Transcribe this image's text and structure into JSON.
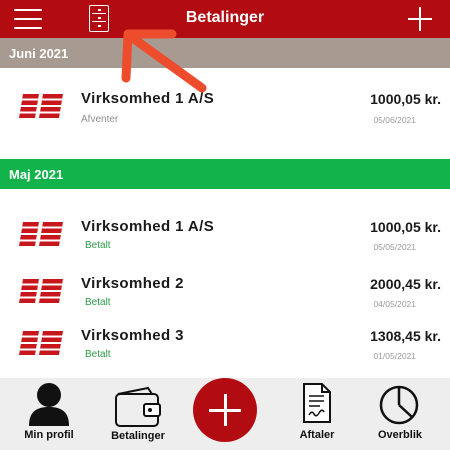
{
  "header": {
    "title": "Betalinger",
    "menu_icon": "hamburger-menu-icon",
    "archive_icon": "file-cabinet-icon",
    "add_icon": "plus-icon"
  },
  "colors": {
    "brand": "#b20b11",
    "june_section": "#a79b91",
    "may_section": "#12b34b",
    "paid_status": "#2e9a48",
    "tutorial_arrow": "#ee4d2d"
  },
  "sections": [
    {
      "title": "Juni 2021",
      "payments": [
        {
          "logo": "DS",
          "company": "Virksomhed 1 A/S",
          "status": "Afventer",
          "amount": "1000,05 kr.",
          "date": "05/06/2021"
        }
      ]
    },
    {
      "title": "Maj 2021",
      "payments": [
        {
          "logo": "DS",
          "company": "Virksomhed 1 A/S",
          "status": "Betalt",
          "amount": "1000,05 kr.",
          "date": "05/05/2021"
        },
        {
          "logo": "DS",
          "company": "Virksomhed 2",
          "status": "Betalt",
          "amount": "2000,45 kr.",
          "date": "04/05/2021"
        },
        {
          "logo": "DS",
          "company": "Virksomhed 3",
          "status": "Betalt",
          "amount": "1308,45 kr.",
          "date": "01/05/2021"
        }
      ]
    }
  ],
  "tabbar": {
    "profile": {
      "label": "Min profil",
      "icon": "person-icon"
    },
    "payments": {
      "label": "Betalinger",
      "icon": "wallet-icon"
    },
    "add": {
      "icon": "plus-icon"
    },
    "agreements": {
      "label": "Aftaler",
      "icon": "signed-document-icon"
    },
    "overview": {
      "label": "Overblik",
      "icon": "clock-pie-icon"
    }
  }
}
